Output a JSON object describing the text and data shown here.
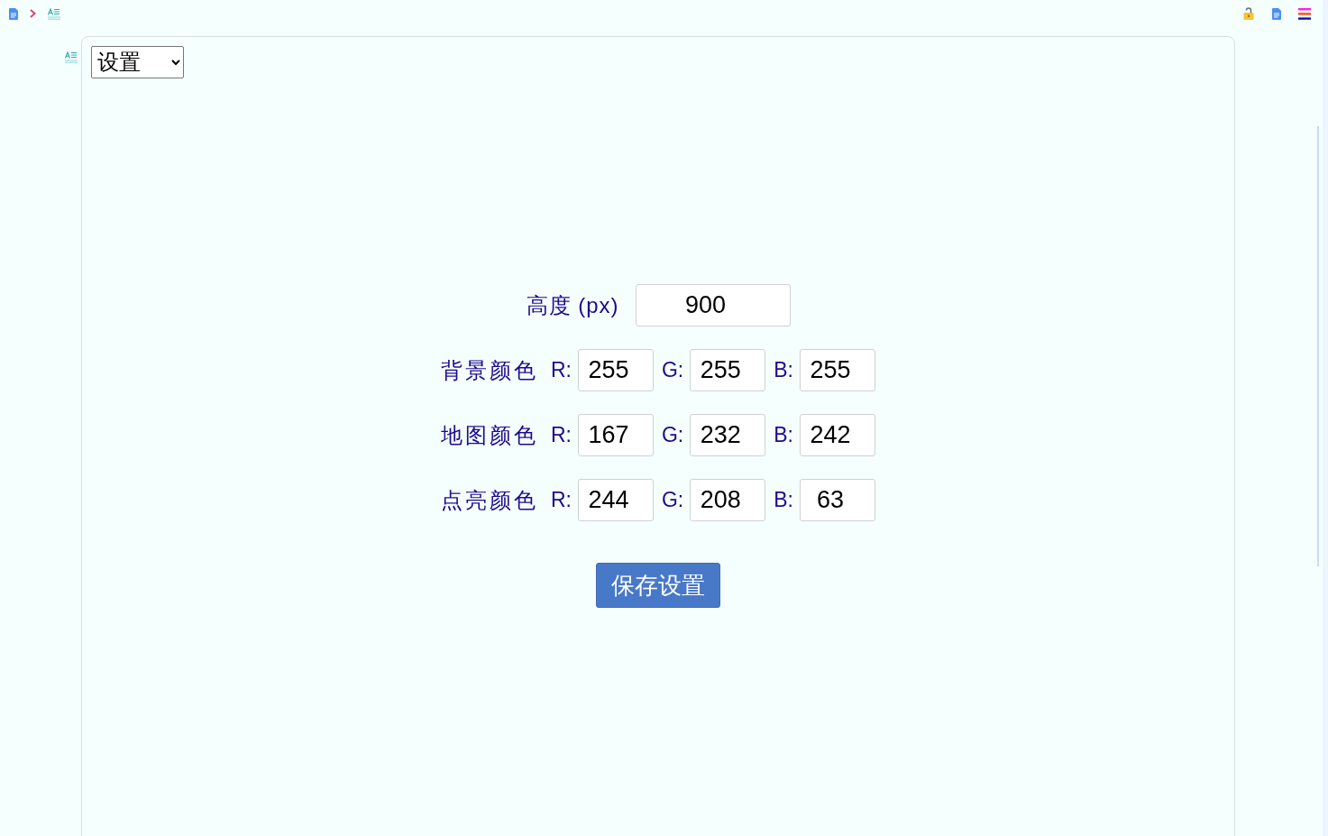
{
  "view_select": {
    "value": "设置"
  },
  "settings_form": {
    "height": {
      "label": "高度 (px)",
      "value": "900"
    },
    "color_rows": [
      {
        "label": "背景颜色",
        "channels": [
          {
            "label": "R:",
            "value": "255"
          },
          {
            "label": "G:",
            "value": "255"
          },
          {
            "label": "B:",
            "value": "255"
          }
        ]
      },
      {
        "label": "地图颜色",
        "channels": [
          {
            "label": "R:",
            "value": "167"
          },
          {
            "label": "G:",
            "value": "232"
          },
          {
            "label": "B:",
            "value": "242"
          }
        ]
      },
      {
        "label": "点亮颜色",
        "channels": [
          {
            "label": "R:",
            "value": "244"
          },
          {
            "label": "G:",
            "value": "208"
          },
          {
            "label": "B:",
            "value": "63"
          }
        ]
      }
    ],
    "save_button": {
      "label": "保存设置"
    }
  }
}
